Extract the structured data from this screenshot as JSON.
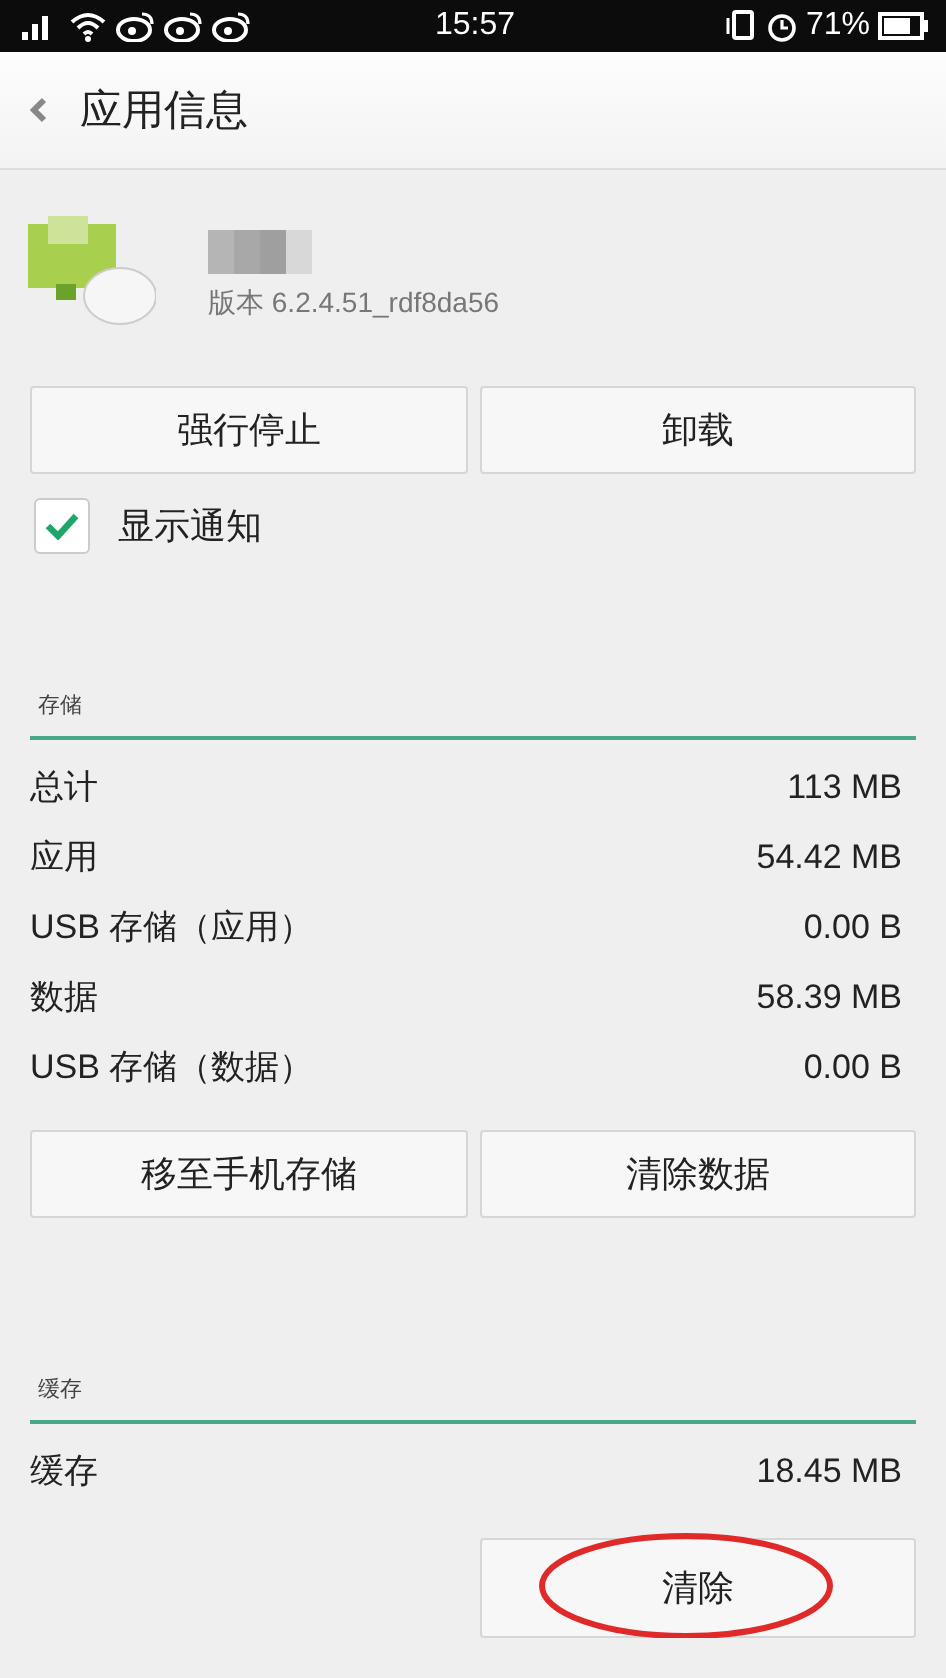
{
  "status_bar": {
    "time": "15:57",
    "battery": "71%"
  },
  "header": {
    "title": "应用信息"
  },
  "app": {
    "version": "版本 6.2.4.51_rdf8da56"
  },
  "actions": [
    {
      "label": "强行停止"
    },
    {
      "label": "卸载"
    }
  ],
  "notification": {
    "label": "显示通知",
    "checked": true
  },
  "storage": {
    "title": "存储",
    "rows": [
      {
        "label": "总计",
        "value": "113 MB"
      },
      {
        "label": "应用",
        "value": "54.42 MB"
      },
      {
        "label": "USB 存储（应用）",
        "value": "0.00 B"
      },
      {
        "label": "数据",
        "value": "58.39 MB"
      },
      {
        "label": "USB 存储（数据）",
        "value": "0.00 B"
      }
    ],
    "buttons": [
      {
        "label": "移至手机存储"
      },
      {
        "label": "清除数据"
      }
    ]
  },
  "cache": {
    "title": "缓存",
    "rows": [
      {
        "label": "缓存",
        "value": "18.45 MB"
      }
    ],
    "button": {
      "label": "清除",
      "circled": true
    }
  }
}
